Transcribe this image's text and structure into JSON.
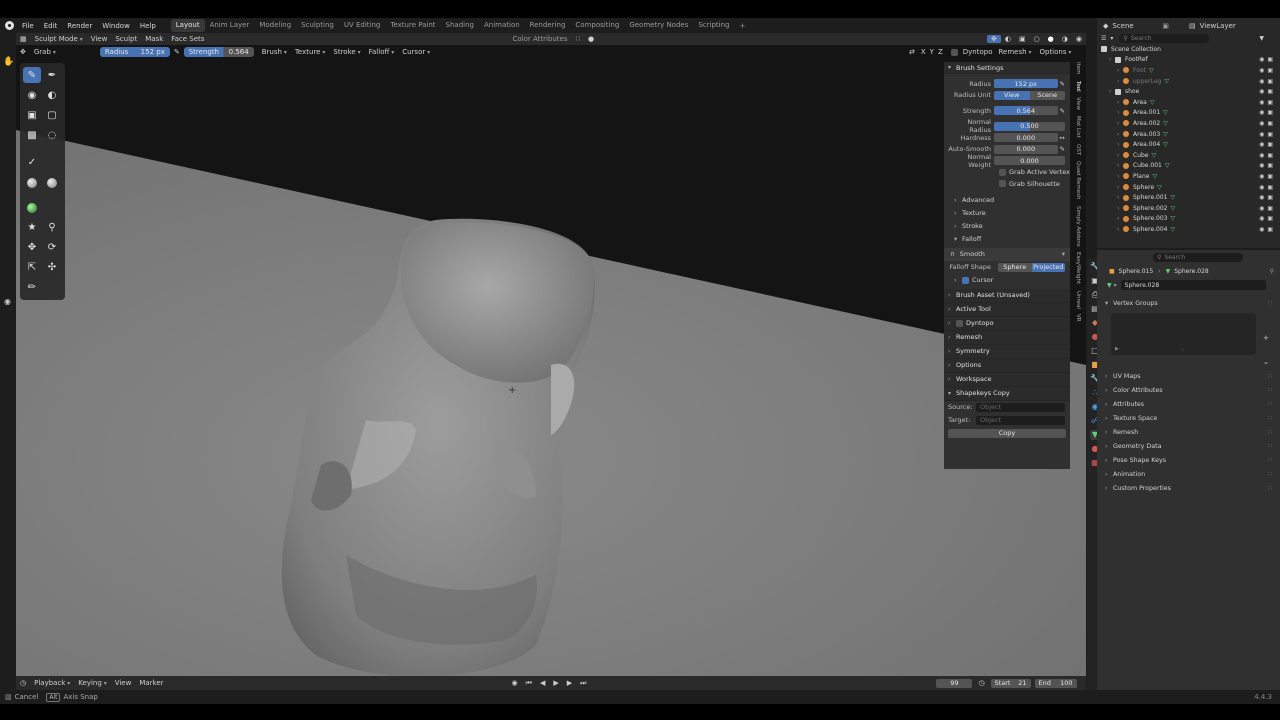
{
  "topbar": {
    "menus": [
      "File",
      "Edit",
      "Render",
      "Window",
      "Help"
    ],
    "workspaces": [
      "Layout",
      "Anim Layer",
      "Modeling",
      "Sculpting",
      "UV Editing",
      "Texture Paint",
      "Shading",
      "Animation",
      "Rendering",
      "Compositing",
      "Geometry Nodes",
      "Scripting"
    ],
    "active_workspace": "Layout",
    "scene": "Scene",
    "view_layer": "ViewLayer"
  },
  "viewport_header": {
    "mode": "Sculpt Mode",
    "menus": [
      "View",
      "Sculpt",
      "Mask",
      "Face Sets"
    ],
    "color_attributes": "Color Attributes",
    "brush": "Grab",
    "radius_label": "Radius",
    "radius_value": "152 px",
    "strength_label": "Strength",
    "strength_value": "0.564",
    "dropdowns": [
      "Brush",
      "Texture",
      "Stroke",
      "Falloff",
      "Cursor"
    ],
    "axes": [
      "X",
      "Y",
      "Z"
    ],
    "right_items": [
      "Dyntopo",
      "Remesh",
      "Options"
    ]
  },
  "brush_settings": {
    "title": "Brush Settings",
    "radius_label": "Radius",
    "radius_value": "152 px",
    "radius_unit_label": "Radius Unit",
    "radius_unit_options": [
      "View",
      "Scene"
    ],
    "radius_unit_active": "View",
    "strength_label": "Strength",
    "strength_value": "0.564",
    "strength_fill": 0.564,
    "normal_radius_label": "Normal Radius",
    "normal_radius_value": "0.500",
    "normal_radius_fill": 0.5,
    "hardness_label": "Hardness",
    "hardness_value": "0.000",
    "auto_smooth_label": "Auto-Smooth",
    "auto_smooth_value": "0.000",
    "normal_weight_label": "Normal Weight",
    "normal_weight_value": "0.000",
    "grab_active_vertex": "Grab Active Vertex",
    "grab_silhouette": "Grab Silhouette",
    "subsections": [
      "Advanced",
      "Texture",
      "Stroke",
      "Falloff"
    ],
    "falloff_curve": "Smooth",
    "falloff_shape_label": "Falloff Shape",
    "falloff_shape_options": [
      "Sphere",
      "Projected"
    ],
    "falloff_shape_active": "Projected",
    "cursor_label": "Cursor",
    "panels": [
      "Brush Asset (Unsaved)",
      "Active Tool",
      "Dyntopo",
      "Remesh",
      "Symmetry",
      "Options",
      "Workspace",
      "Shapekeys Copy"
    ],
    "source_label": "Source:",
    "target_label": "Target:",
    "object_placeholder": "Object",
    "copy_button": "Copy"
  },
  "side_tabs": [
    "Item",
    "Tool",
    "View",
    "Mat List",
    "OST",
    "Quad Remesh",
    "Simply Addons",
    "EasyWeight",
    "Unreal",
    "VR"
  ],
  "outliner": {
    "search_placeholder": "Search",
    "root": "Scene Collection",
    "items": [
      {
        "name": "FootRef",
        "type": "collection",
        "indent": 1
      },
      {
        "name": "Foot",
        "type": "object",
        "indent": 2,
        "dim": true
      },
      {
        "name": "upperLeg",
        "type": "object",
        "indent": 2,
        "dim": true
      },
      {
        "name": "shoe",
        "type": "collection",
        "indent": 1
      },
      {
        "name": "Area",
        "type": "object",
        "indent": 2
      },
      {
        "name": "Area.001",
        "type": "object",
        "indent": 2
      },
      {
        "name": "Area.002",
        "type": "object",
        "indent": 2
      },
      {
        "name": "Area.003",
        "type": "object",
        "indent": 2
      },
      {
        "name": "Area.004",
        "type": "object",
        "indent": 2
      },
      {
        "name": "Cube",
        "type": "object",
        "indent": 2
      },
      {
        "name": "Cube.001",
        "type": "object",
        "indent": 2
      },
      {
        "name": "Plane",
        "type": "object",
        "indent": 2
      },
      {
        "name": "Sphere",
        "type": "object",
        "indent": 2
      },
      {
        "name": "Sphere.001",
        "type": "object",
        "indent": 2
      },
      {
        "name": "Sphere.002",
        "type": "object",
        "indent": 2
      },
      {
        "name": "Sphere.003",
        "type": "object",
        "indent": 2
      },
      {
        "name": "Sphere.004",
        "type": "object",
        "indent": 2
      }
    ]
  },
  "properties": {
    "search_placeholder": "Search",
    "breadcrumb_object": "Sphere.015",
    "breadcrumb_mesh": "Sphere.028",
    "data_name": "Sphere.028",
    "vertex_groups": "Vertex Groups",
    "sections": [
      "UV Maps",
      "Color Attributes",
      "Attributes",
      "Texture Space",
      "Remesh",
      "Geometry Data",
      "Pose Shape Keys",
      "Animation",
      "Custom Properties"
    ]
  },
  "timeline": {
    "menus": [
      "Playback",
      "Keying",
      "View",
      "Marker"
    ],
    "current_frame": "99",
    "start_label": "Start",
    "start_value": "21",
    "end_label": "End",
    "end_value": "100"
  },
  "statusbar": {
    "cancel": "Cancel",
    "axis_snap_key": "Alt",
    "axis_snap": "Axis Snap",
    "version": "4.4.3"
  }
}
